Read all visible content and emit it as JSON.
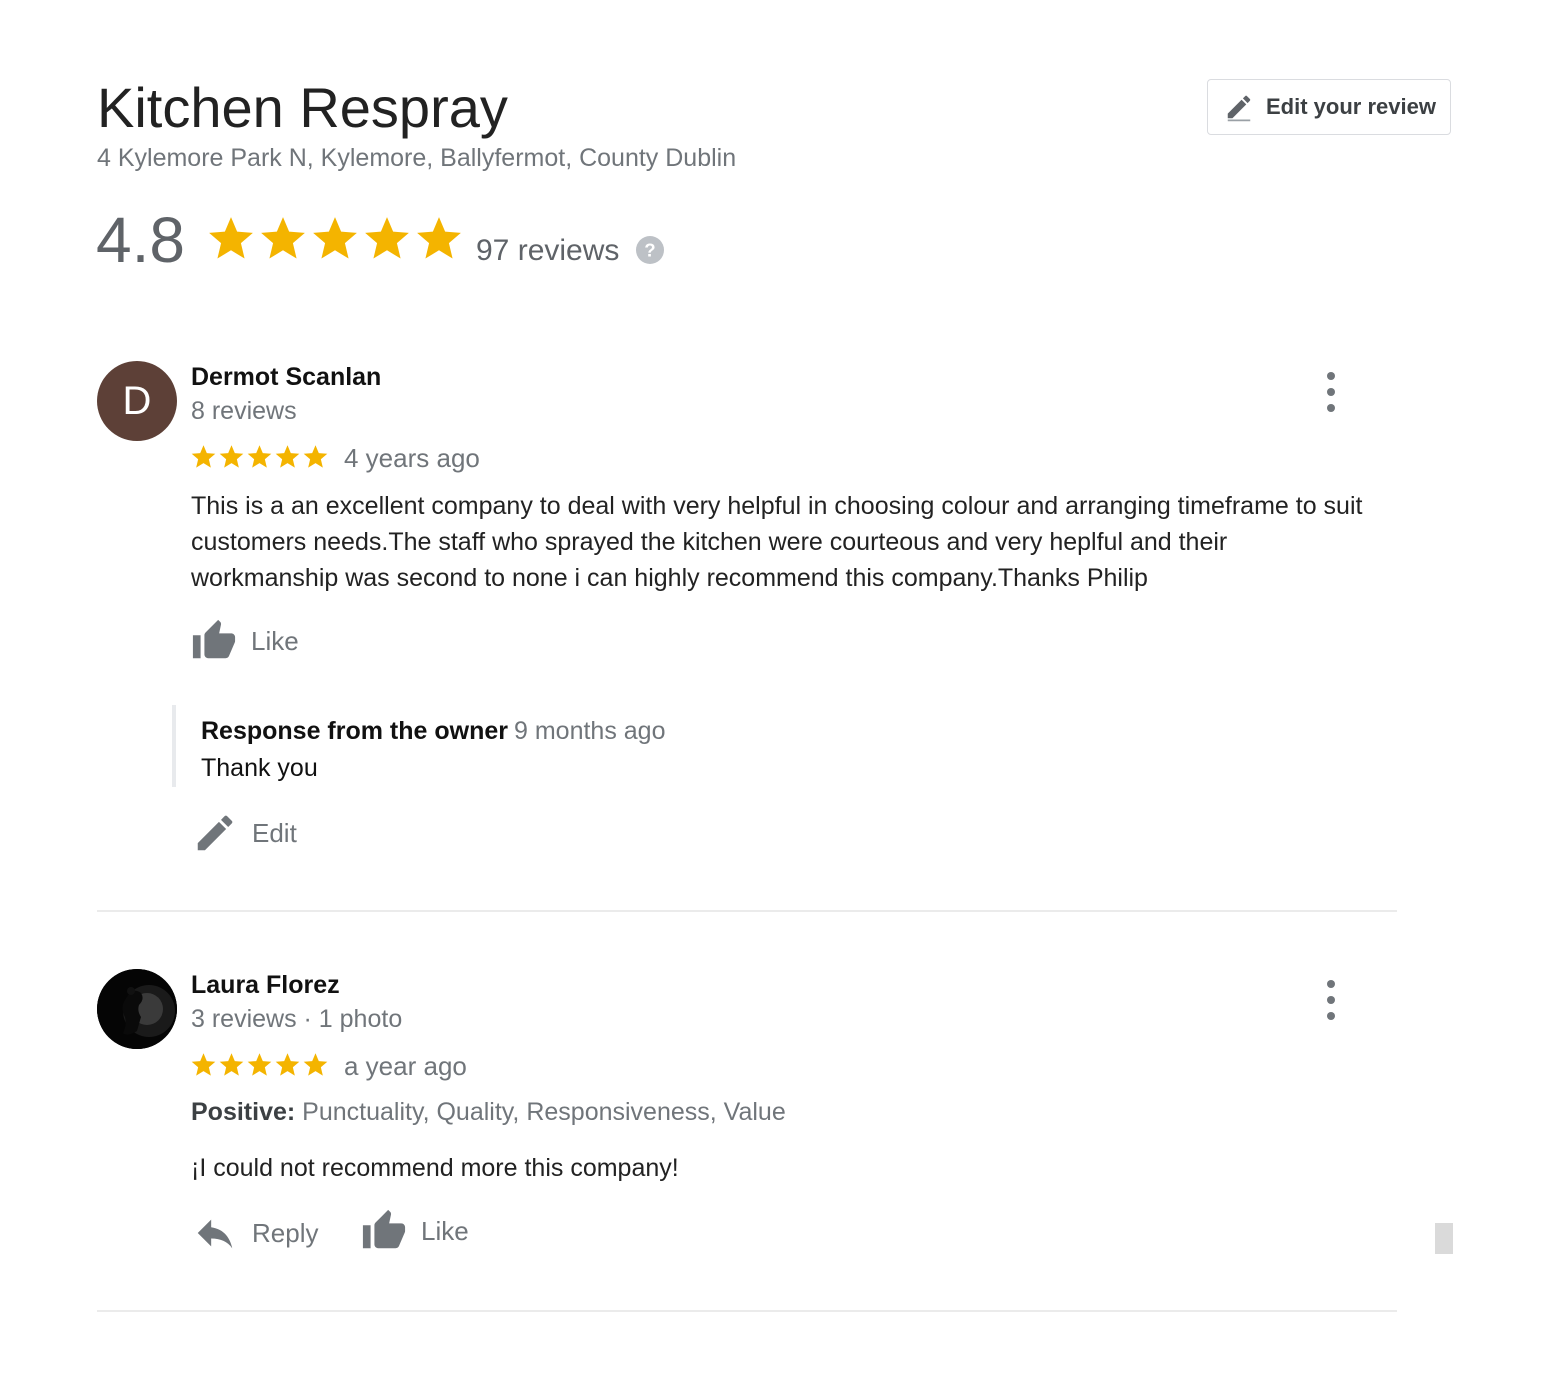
{
  "business": {
    "name": "Kitchen Respray",
    "address": "4 Kylemore Park N, Kylemore, Ballyfermot, County Dublin",
    "rating": "4.8",
    "stars": 5,
    "review_count": "97 reviews"
  },
  "edit_review_button": {
    "label": "Edit your review",
    "icon": "pencil-icon"
  },
  "colors": {
    "star": "#f4b400",
    "muted": "#70757a",
    "avatar_d": "#5d4037"
  },
  "reviews": [
    {
      "avatar_letter": "D",
      "name": "Dermot Scanlan",
      "meta": "8 reviews",
      "stars": 5,
      "time": "4 years ago",
      "text": "This is a an excellent company to deal with very helpful in choosing colour and arranging timeframe to suit customers needs.The staff who sprayed the kitchen were courteous and very heplful and their workmanship was second to none i can highly recommend this company.Thanks Philip",
      "like_label": "Like",
      "owner_response": {
        "label": "Response from the owner",
        "time": "9 months ago",
        "text": "Thank you"
      },
      "edit_label": "Edit"
    },
    {
      "name": "Laura Florez",
      "meta": "3 reviews · 1 photo",
      "stars": 5,
      "time": "a year ago",
      "positive_label": "Positive:",
      "positive_values": "Punctuality, Quality, Responsiveness, Value",
      "text": "¡I could not recommend more this company!",
      "reply_label": "Reply",
      "like_label": "Like"
    }
  ]
}
